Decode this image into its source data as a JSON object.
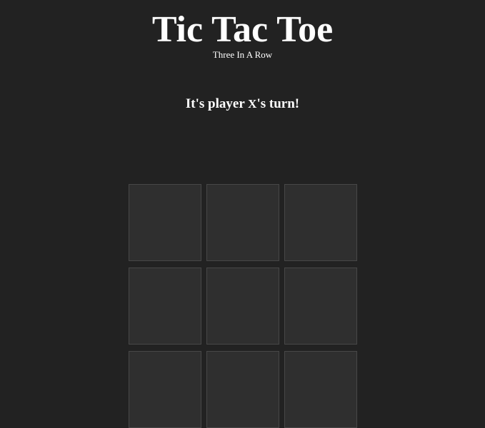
{
  "header": {
    "title": "Tic Tac Toe",
    "subtitle": "Three In A Row"
  },
  "status": {
    "prefix": "It's player ",
    "current_player": "X",
    "suffix": "'s turn!"
  },
  "board": {
    "cells": [
      "",
      "",
      "",
      "",
      "",
      "",
      "",
      "",
      ""
    ]
  },
  "colors": {
    "background": "#222222",
    "cell_fill": "#2f2f2f",
    "cell_border": "#474747",
    "text": "#ffffff"
  }
}
